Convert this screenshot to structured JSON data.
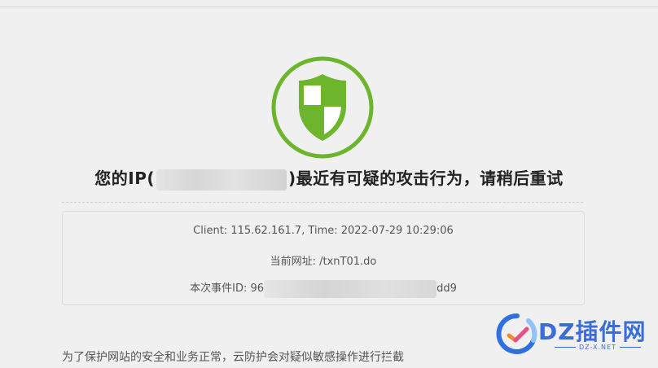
{
  "headline": {
    "prefix": "您的IP(",
    "suffix": ")最近有可疑的攻击行为，请稍后重试"
  },
  "info": {
    "client_line": "Client: 115.62.161.7, Time: 2022-07-29 10:29:06",
    "url_label": "当前网址: ",
    "url_value": "/txnT01.do",
    "event_label": "本次事件ID: ",
    "event_prefix": "96",
    "event_suffix": "dd9"
  },
  "notice": "为了保护网站的安全和业务正常，云防护会对疑似敏感操作进行拦截",
  "watermark": {
    "text": "DZ插件网",
    "subtext": "DZ-X.NET"
  },
  "colors": {
    "shield_green": "#6cb52d",
    "watermark_blue": "#3a6dd8",
    "background": "#f0f0f0"
  },
  "icons": {
    "shield": "shield-check-icon"
  }
}
